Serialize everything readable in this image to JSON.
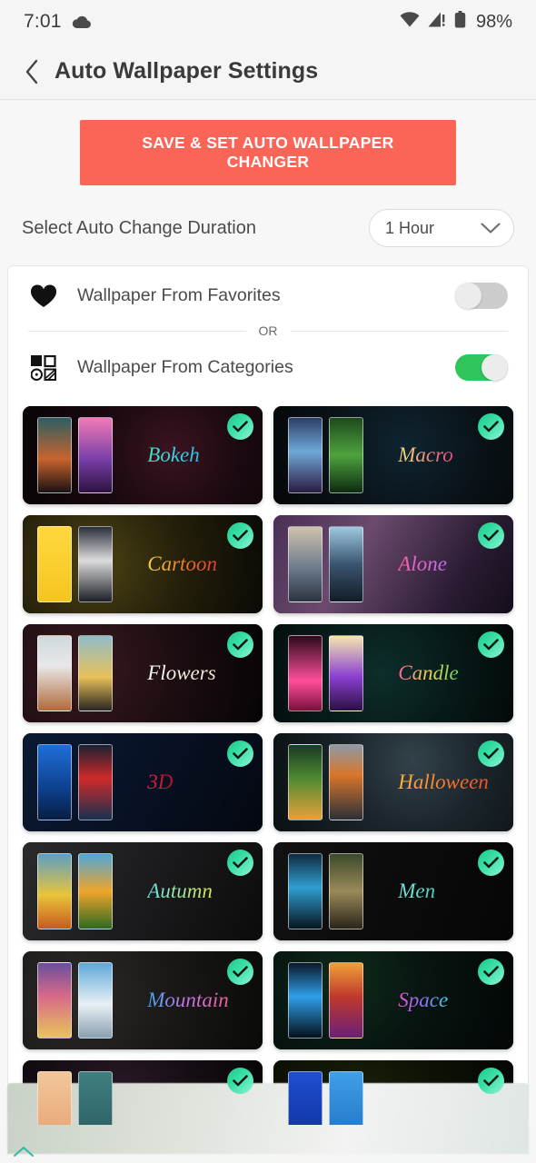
{
  "status_bar": {
    "time": "7:01",
    "cloud_icon": "cloud-icon",
    "wifi_icon": "wifi-icon",
    "signal_icon": "cellular-signal-alert-icon",
    "battery_icon": "battery-icon",
    "battery_text": "98%"
  },
  "app_bar": {
    "back_icon": "back-chevron-icon",
    "title": "Auto Wallpaper Settings"
  },
  "actions": {
    "save_label": "SAVE & SET AUTO WALLPAPER CHANGER",
    "save_color": "#fa6558"
  },
  "duration": {
    "label": "Select Auto Change Duration",
    "selected": "1 Hour",
    "caret_icon": "chevron-down-icon"
  },
  "sources": {
    "favorites": {
      "icon": "heart-icon",
      "label": "Wallpaper From Favorites",
      "enabled": false
    },
    "divider_text": "OR",
    "categories": {
      "icon": "grid-icon",
      "label": "Wallpaper From Categories",
      "enabled": true,
      "toggle_on_color": "#2fc55b"
    }
  },
  "categories_grid": {
    "badge_icon": "check-badge-icon",
    "items": [
      {
        "name": "Bokeh",
        "selected": true,
        "text_gradient": "linear-gradient(90deg,#46e0b0,#39d6e8,#2bbff0)",
        "bg": "radial-gradient(circle at 62% 46%, #3a1420 0%, #1a0910 45%, #080406 100%)",
        "thumb1": "linear-gradient(180deg,#2d5d63,#c9642e 55%,#1a1212)",
        "thumb2": "linear-gradient(180deg,#f07bb5,#7a3fa8 55%,#2b1340)"
      },
      {
        "name": "Macro",
        "selected": true,
        "text_gradient": "linear-gradient(90deg,#f2e37a,#e8467f)",
        "bg": "radial-gradient(circle at 55% 40%, #0f2430 0%, #0a1319 50%, #050708 100%)",
        "thumb1": "linear-gradient(180deg,#2b3f66,#6fa8d8 45%,#2a1b40)",
        "thumb2": "linear-gradient(180deg,#1d4a1e,#4ea33d 50%,#0d2a11)"
      },
      {
        "name": "Cartoon",
        "selected": true,
        "text_gradient": "linear-gradient(90deg,#f7d34a,#ef7a2c,#e03b2e)",
        "bg": "radial-gradient(circle at 30% 50%, #4b4314 0%, #241f0a 50%, #0b0a05 100%)",
        "thumb1": "linear-gradient(180deg,#ffd83f,#f5c51f)",
        "thumb2": "linear-gradient(180deg,#2a2f3a,#dcdcdc 45%,#1c1f26)"
      },
      {
        "name": "Alone",
        "selected": true,
        "text_gradient": "linear-gradient(90deg,#ff5fa8,#c26bf0)",
        "bg": "linear-gradient(120deg,#4a2f55 0%,#6b4a6e 35%,#2a1c33 75%,#140d1a 100%)",
        "thumb1": "linear-gradient(180deg,#cfc2ae,#6d7b8c 55%,#2b3340)",
        "thumb2": "linear-gradient(180deg,#9fc8e0,#3a5570 50%,#121c26)"
      },
      {
        "name": "Flowers",
        "selected": true,
        "text_gradient": "linear-gradient(90deg,#ffffff,#efe6d2)",
        "bg": "radial-gradient(circle at 25% 45%, #3a1a20 0%, #1c0d11 50%, #070405 100%)",
        "thumb1": "linear-gradient(180deg,#cfd8dd,#e8e8e8 40%,#b06a3a)",
        "thumb2": "linear-gradient(180deg,#8fbcc8,#e8c15a 55%,#2a2620)"
      },
      {
        "name": "Candle",
        "selected": true,
        "text_gradient": "linear-gradient(90deg,#ff5f9e,#f2d24a,#62d96a)",
        "bg": "radial-gradient(circle at 45% 50%, #0d2e2a 0%, #071a19 50%, #030909 100%)",
        "thumb1": "linear-gradient(180deg,#2a0a1a,#ff4f9a 60%,#7a0f3a)",
        "thumb2": "linear-gradient(180deg,#f5e7b0,#8a3fd0 55%,#2a1040)"
      },
      {
        "name": "3D",
        "selected": true,
        "text_gradient": "linear-gradient(90deg,#e8243f,#b01028)",
        "bg": "linear-gradient(120deg,#0b1a33 0%,#081226 45%,#04080f 100%)",
        "thumb1": "linear-gradient(180deg,#1f6fd8,#0d3f8c 60%,#071e40)",
        "thumb2": "linear-gradient(180deg,#1a2030,#d02a2a 45%,#16304f)"
      },
      {
        "name": "Halloween",
        "selected": true,
        "text_gradient": "linear-gradient(90deg,#ffb347,#ff7a2c,#e8532a)",
        "bg": "radial-gradient(circle at 58% 28%, #33424a 0%, #1a242a 45%, #0a1013 100%)",
        "thumb1": "linear-gradient(180deg,#1a3a22,#4f8a32 45%,#e8a03a)",
        "thumb2": "linear-gradient(180deg,#8d9aa6,#d9762a 40%,#2b3038)"
      },
      {
        "name": "Autumn",
        "selected": true,
        "text_gradient": "linear-gradient(90deg,#62e0e8,#d8e84a)",
        "bg": "linear-gradient(115deg,#2a2a2c 0%,#1d1c1e 45%,#0c0b0c 100%)",
        "thumb1": "linear-gradient(180deg,#5d9fc4,#e8c43a 55%,#c85a1f)",
        "thumb2": "linear-gradient(180deg,#4fa6d8,#f0a52a 50%,#2f6a22)"
      },
      {
        "name": "Men",
        "selected": true,
        "text_gradient": "linear-gradient(90deg,#7fe8d8,#3fd0c0)",
        "bg": "linear-gradient(110deg,#121212 0%,#0b0b0b 50%,#060606 100%)",
        "thumb1": "linear-gradient(180deg,#0f2a3f,#2f9fd0 45%,#081520)",
        "thumb2": "linear-gradient(180deg,#3c4a2a,#9a8a5a 50%,#2a2418)"
      },
      {
        "name": "Mountain",
        "selected": true,
        "text_gradient": "linear-gradient(90deg,#3fa8f0,#c76fe8,#ef5f9a)",
        "bg": "radial-gradient(circle at 22% 45%, #2c2b2a 0%, #191817 50%, #0a0a09 100%)",
        "thumb1": "linear-gradient(180deg,#6a4f9a,#d86a8a 45%,#e8c45a)",
        "thumb2": "linear-gradient(180deg,#5fa8d8,#e8f0f5 55%,#8aa0b0)"
      },
      {
        "name": "Space",
        "selected": true,
        "text_gradient": "linear-gradient(90deg,#e84fd8,#8a6ff0,#3fd8e8)",
        "bg": "radial-gradient(circle at 30% 30%, #0f2a1a 0%, #071410 45%, #030606 100%)",
        "thumb1": "linear-gradient(180deg,#0a1828,#2f9fe8 45%,#05101c)",
        "thumb2": "linear-gradient(180deg,#f0a03a,#c0392b 45%,#6a1f7a)"
      },
      {
        "name": "",
        "selected": true,
        "text_gradient": "linear-gradient(90deg,#ffffff,#ffffff)",
        "bg": "radial-gradient(circle at 40% 40%, #2a1a28 0%, #150d14 50%, #070406 100%)",
        "thumb1": "linear-gradient(180deg,#f0c79a,#e8a070)",
        "thumb2": "linear-gradient(180deg,#3f7f80,#2a5a60)"
      },
      {
        "name": "",
        "selected": true,
        "text_gradient": "linear-gradient(90deg,#ffffff,#ffffff)",
        "bg": "radial-gradient(circle at 35% 50%, #1a2208 0%, #0d1205 50%, #040603 100%)",
        "thumb1": "linear-gradient(180deg,#1f4fd0,#0f2f9a)",
        "thumb2": "linear-gradient(180deg,#3f9fe8,#1f6fc0)"
      }
    ]
  },
  "bottom_bar": {
    "chevron_icon": "chevron-up-icon",
    "chevron_color": "#2fb8a8"
  }
}
